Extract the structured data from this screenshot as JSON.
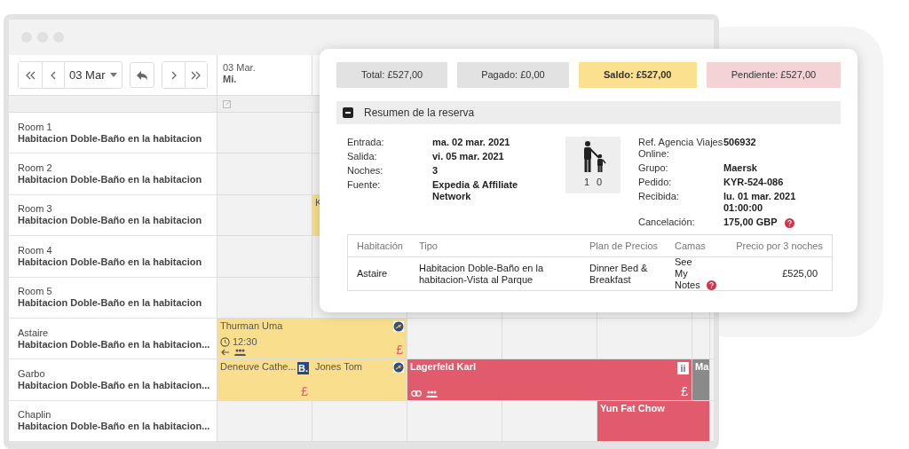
{
  "toolbar": {
    "buttons": [
      {
        "kind": "first"
      },
      {
        "kind": "prev"
      }
    ],
    "date": "03 Mar",
    "after": [
      {
        "kind": "reply"
      }
    ],
    "right": [
      {
        "kind": "next"
      },
      {
        "kind": "last"
      }
    ]
  },
  "columns": [
    {
      "date": "03 Mar.",
      "day": "Mi."
    }
  ],
  "rooms": [
    {
      "name": "Room 1",
      "type": "Habitacion Doble-Baño en la habitacion",
      "slots": [
        {
          "kind": "empty"
        },
        {
          "kind": "empty"
        },
        {
          "kind": "empty"
        },
        {
          "kind": "empty"
        },
        {
          "kind": "empty"
        },
        {
          "kind": "empty"
        }
      ]
    },
    {
      "name": "Room 2",
      "type": "Habitacion Doble-Baño en la habitacion",
      "slots": [
        {
          "kind": "empty"
        },
        {
          "kind": "empty"
        },
        {
          "kind": "empty"
        },
        {
          "kind": "empty"
        },
        {
          "kind": "empty"
        },
        {
          "kind": "empty"
        }
      ]
    },
    {
      "name": "Room 3",
      "type": "Habitacion Doble-Baño en la habitacion",
      "slots": [
        {
          "kind": "empty"
        },
        {
          "kind": "booking",
          "name": "K",
          "color": "#f9df8d"
        },
        {
          "kind": "continued"
        },
        {
          "kind": "empty"
        },
        {
          "kind": "empty"
        },
        {
          "kind": "empty"
        }
      ]
    },
    {
      "name": "Room 4",
      "type": "Habitacion Doble-Baño en la habitacion",
      "slots": [
        {
          "kind": "empty"
        },
        {
          "kind": "empty"
        },
        {
          "kind": "empty"
        },
        {
          "kind": "empty"
        },
        {
          "kind": "empty"
        },
        {
          "kind": "empty"
        }
      ]
    },
    {
      "name": "Room 5",
      "type": "Habitacion Doble-Baño en la habitacion",
      "slots": [
        {
          "kind": "empty"
        },
        {
          "kind": "empty"
        },
        {
          "kind": "empty"
        },
        {
          "kind": "empty"
        },
        {
          "kind": "empty"
        },
        {
          "kind": "empty"
        }
      ]
    },
    {
      "name": "Astaire",
      "type": "Habitacion Doble-Baño en la habitacion...",
      "slots": [
        {
          "kind": "booking",
          "name": "Thurman Uma",
          "color": "#f9df8d",
          "badge": {
            "kind": "globe"
          },
          "time": "12:30",
          "icons": [
            {
              "kind": "arrow"
            },
            {
              "kind": "group"
            }
          ],
          "currency": "£"
        },
        {
          "kind": "continued"
        },
        {
          "kind": "empty"
        },
        {
          "kind": "empty"
        },
        {
          "kind": "empty"
        },
        {
          "kind": "empty"
        }
      ]
    },
    {
      "name": "Garbo",
      "type": "Habitacion Doble-Baño en la habitacion...",
      "slots": [
        {
          "kind": "booking",
          "name": "Deneuve Cathe...",
          "color": "#f9df8d",
          "badge": {
            "kind": "text",
            "text": "B."
          },
          "currency": "£"
        },
        {
          "kind": "booking",
          "name": "Jones Tom",
          "color": "#f9df8d",
          "badge": {
            "kind": "globe"
          }
        },
        {
          "kind": "booking",
          "name": "Lagerfeld Karl",
          "color": "#e15b6c",
          "badge": {
            "kind": "text",
            "text": "ii"
          },
          "icons": [
            {
              "kind": "link"
            },
            {
              "kind": "group"
            }
          ],
          "currency": "£"
        },
        {
          "kind": "continued"
        },
        {
          "kind": "continued"
        },
        {
          "kind": "booking",
          "name": "Ma",
          "color": "#8a8a8a"
        }
      ]
    },
    {
      "name": "Chaplin",
      "type": "Habitacion Doble-Baño en la habitacion...",
      "slots": [
        {
          "kind": "empty"
        },
        {
          "kind": "empty"
        },
        {
          "kind": "empty"
        },
        {
          "kind": "empty"
        },
        {
          "kind": "booking",
          "name": "Yun Fat Chow",
          "color": "#e15b6c"
        },
        {
          "kind": "continued"
        }
      ]
    }
  ],
  "popup": {
    "totals": [
      {
        "label": "Total: £527,00",
        "color": "#e2e2e2",
        "bold": false
      },
      {
        "label": "Pagado: £0,00",
        "color": "#e2e2e2",
        "bold": false
      },
      {
        "label": "Saldo: £527,00",
        "color": "#fbe08f",
        "bold": true
      },
      {
        "label": "Pendiente: £527,00",
        "color": "#f4d3d7",
        "bold": false
      }
    ],
    "section": {
      "title": "Resumen de la reserva",
      "expanded": true
    },
    "details_left": [
      {
        "label": "Entrada:",
        "value": "ma. 02 mar. 2021"
      },
      {
        "label": "Salida:",
        "value": "vi. 05 mar. 2021"
      },
      {
        "label": "Noches:",
        "value": "3"
      },
      {
        "label": "Fuente:",
        "value": "Expedia & Affiliate Network"
      }
    ],
    "guests": {
      "adults": "1",
      "children": "0"
    },
    "details_right": [
      {
        "label": "Ref. Agencia Viajes Online:",
        "value": "506932"
      },
      {
        "label": "Grupo:",
        "value": "Maersk"
      },
      {
        "label": "Pedido:",
        "value": "KYR-524-086"
      },
      {
        "label": "Recibida:",
        "value": "lu. 01 mar. 2021 01:00:00"
      },
      {
        "label": "Cancelación:",
        "value": "175,00 GBP",
        "help": true
      }
    ],
    "table": {
      "columns": [
        "Habitación",
        "Tipo",
        "Plan de Precios",
        "Camas",
        "Precio por 3 noches"
      ],
      "rows": [
        {
          "cells": [
            "Astaire",
            "Habitacion Doble-Baño en la habitacion-Vista al Parque",
            "Dinner Bed & Breakfast",
            "See My Notes",
            "£525,00"
          ],
          "help": true
        }
      ]
    }
  }
}
